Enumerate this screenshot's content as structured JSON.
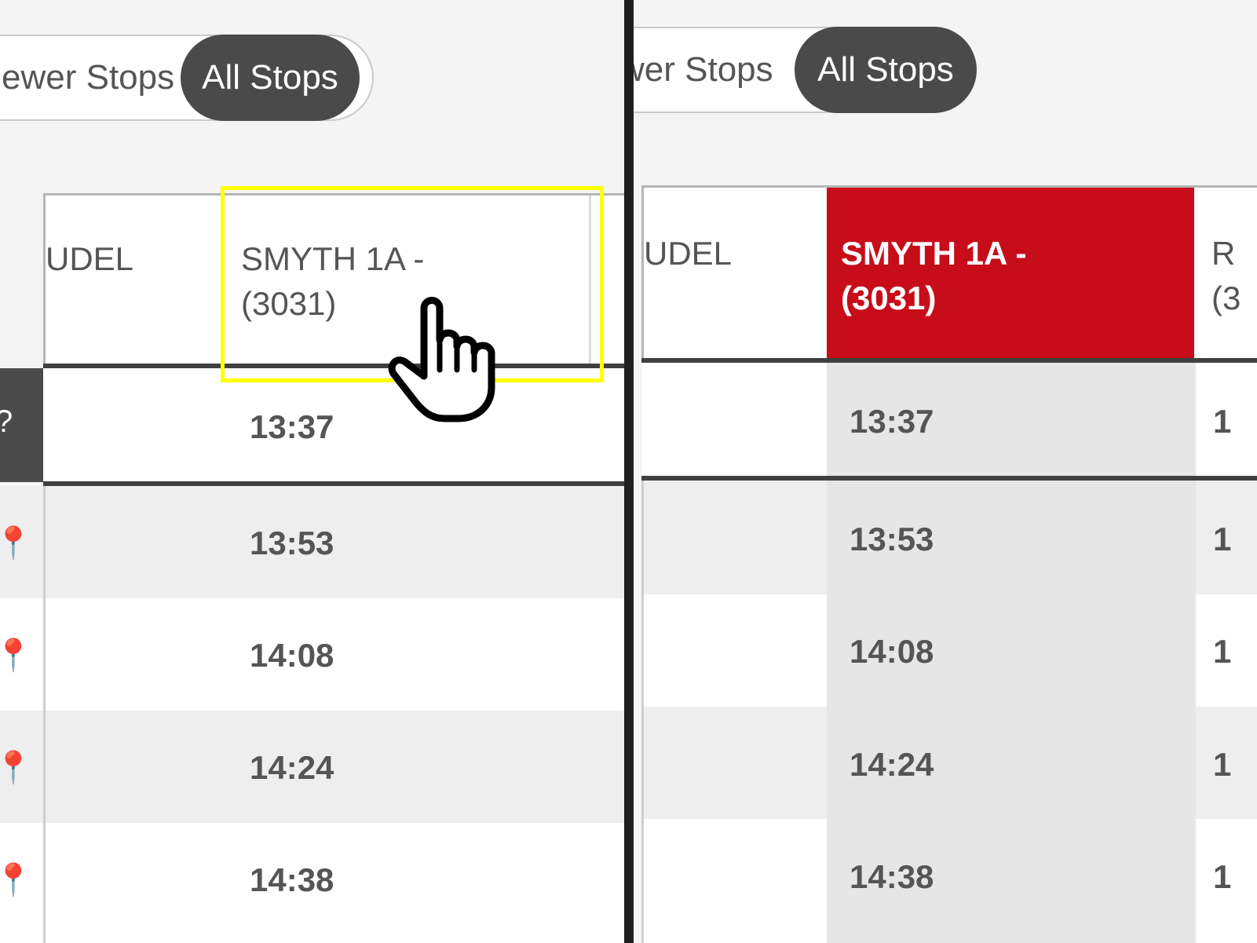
{
  "colors": {
    "accent_red": "#c70d1a",
    "pill_dark": "#4a4a4a",
    "highlight_yellow": "#ffff00",
    "row_alt": "#eeeeee"
  },
  "left": {
    "toggle": {
      "fewer_label": "ewer Stops",
      "all_label": "All Stops"
    },
    "header": {
      "prev_stop": "UDEL",
      "selected_stop": "SMYTH 1A -\n(3031)"
    },
    "times": [
      "13:37",
      "13:53",
      "14:08",
      "14:24",
      "14:38"
    ]
  },
  "right": {
    "toggle": {
      "fewer_label": "wer Stops",
      "all_label": "All Stops"
    },
    "header": {
      "prev_stop": "UDEL",
      "selected_stop": "SMYTH 1A -\n(3031)",
      "next_stop_partial": "R\n(3"
    },
    "times": [
      "13:37",
      "13:53",
      "14:08",
      "14:24",
      "14:38"
    ],
    "next_times_partial": [
      "1",
      "1",
      "1",
      "1",
      "1"
    ]
  }
}
